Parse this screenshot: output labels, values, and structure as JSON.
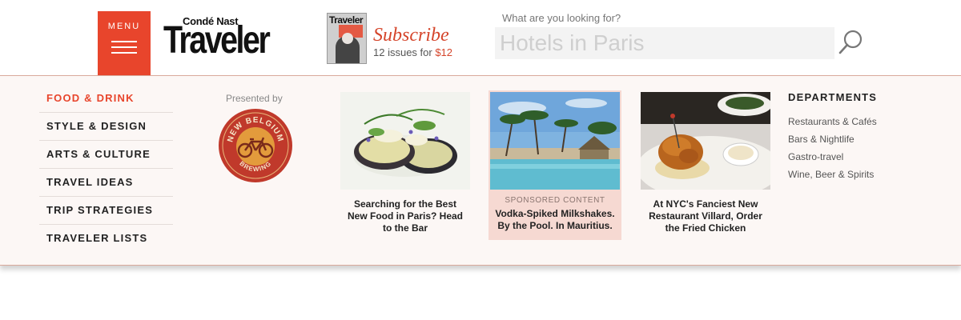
{
  "header": {
    "menu_label": "MENU",
    "logo_top": "Condé Nast",
    "logo_main": "Traveler",
    "magazine_cover_title": "Traveler",
    "subscribe_title": "Subscribe",
    "subscribe_line_prefix": "12 issues for",
    "subscribe_price": "$12",
    "search_label": "What are you looking for?",
    "search_placeholder": "Hotels in Paris"
  },
  "nav": {
    "items": [
      {
        "label": "FOOD & DRINK",
        "active": true
      },
      {
        "label": "STYLE & DESIGN",
        "active": false
      },
      {
        "label": "ARTS & CULTURE",
        "active": false
      },
      {
        "label": "TRAVEL IDEAS",
        "active": false
      },
      {
        "label": "TRIP STRATEGIES",
        "active": false
      },
      {
        "label": "TRAVELER LISTS",
        "active": false
      }
    ]
  },
  "sponsor": {
    "presented_by": "Presented by",
    "logo_text_top": "NEW BELGIUM",
    "logo_text_bottom": "BREWING"
  },
  "cards": [
    {
      "caption": "Searching for the Best New Food in Paris? Head to the Bar",
      "sponsored": false
    },
    {
      "tag": "SPONSORED CONTENT",
      "caption": "Vodka-Spiked Milkshakes. By the Pool. In Mauritius.",
      "sponsored": true
    },
    {
      "caption": "At NYC's Fanciest New Restaurant Villard, Order the Fried Chicken",
      "sponsored": false
    }
  ],
  "departments": {
    "title": "DEPARTMENTS",
    "links": [
      "Restaurants & Cafés",
      "Bars & Nightlife",
      "Gastro-travel",
      "Wine, Beer & Spirits"
    ]
  },
  "colors": {
    "accent": "#e8452c",
    "panel_bg": "#fcf7f5",
    "sponsored_bg": "#f6d9d2"
  }
}
